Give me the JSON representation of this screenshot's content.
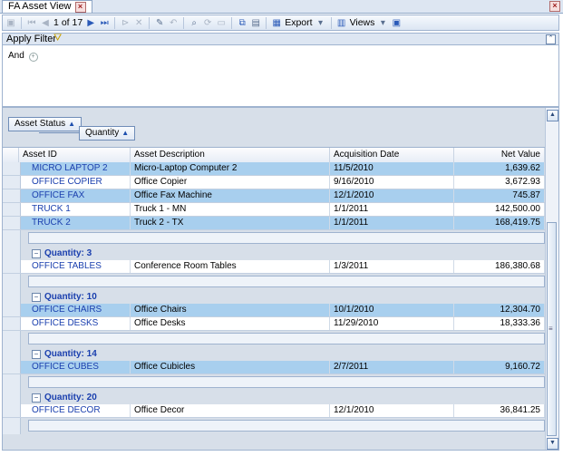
{
  "tab": {
    "title": "FA Asset View"
  },
  "toolbar": {
    "page_current": "1",
    "page_total": "of 17",
    "export_label": "Export",
    "views_label": "Views"
  },
  "filter": {
    "title": "Apply Filter",
    "and_label": "And"
  },
  "grouping": {
    "chip1": "Asset Status",
    "chip2": "Quantity"
  },
  "columns": [
    "Asset ID",
    "Asset Description",
    "Acquisition Date",
    "Net Value"
  ],
  "top_rows": [
    {
      "id": "MICRO LAPTOP 2",
      "desc": "Micro-Laptop Computer 2",
      "date": "11/5/2010",
      "value": "1,639.62",
      "sel": true
    },
    {
      "id": "OFFICE COPIER",
      "desc": "Office Copier",
      "date": "9/16/2010",
      "value": "3,672.93",
      "sel": false
    },
    {
      "id": "OFFICE FAX",
      "desc": "Office Fax Machine",
      "date": "12/1/2010",
      "value": "745.87",
      "sel": true
    },
    {
      "id": "TRUCK 1",
      "desc": "Truck 1 - MN",
      "date": "1/1/2011",
      "value": "142,500.00",
      "sel": false
    },
    {
      "id": "TRUCK 2",
      "desc": "Truck 2 - TX",
      "date": "1/1/2011",
      "value": "168,419.75",
      "sel": true
    }
  ],
  "groups": [
    {
      "label": "Quantity: 3",
      "rows": [
        {
          "id": "OFFICE TABLES",
          "desc": "Conference Room Tables",
          "date": "1/3/2011",
          "value": "186,380.68",
          "sel": false
        }
      ]
    },
    {
      "label": "Quantity: 10",
      "rows": [
        {
          "id": "OFFICE CHAIRS",
          "desc": "Office Chairs",
          "date": "10/1/2010",
          "value": "12,304.70",
          "sel": true
        },
        {
          "id": "OFFICE DESKS",
          "desc": "Office Desks",
          "date": "11/29/2010",
          "value": "18,333.36",
          "sel": false
        }
      ]
    },
    {
      "label": "Quantity: 14",
      "rows": [
        {
          "id": "OFFICE CUBES",
          "desc": "Office Cubicles",
          "date": "2/7/2011",
          "value": "9,160.72",
          "sel": true
        }
      ]
    },
    {
      "label": "Quantity: 20",
      "rows": [
        {
          "id": "OFFICE DECOR",
          "desc": "Office Decor",
          "date": "12/1/2010",
          "value": "36,841.25",
          "sel": false
        }
      ]
    }
  ]
}
